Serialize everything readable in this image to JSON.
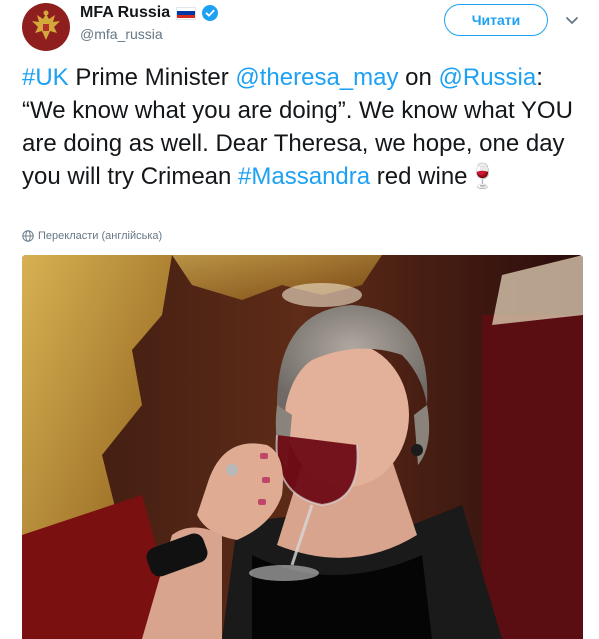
{
  "user": {
    "display_name": "MFA Russia",
    "handle": "@mfa_russia",
    "flag_icon": "russian-flag-icon",
    "verified_icon": "verified-badge-icon"
  },
  "actions": {
    "follow_label": "Читати",
    "menu_icon": "chevron-down-icon"
  },
  "tweet": {
    "hashtag_uk": "#UK",
    "text1": " Prime Minister ",
    "mention_may": "@theresa_may",
    "text2": " on ",
    "mention_russia": "@Russia",
    "text3": ": “We know what you are doing”. We know what YOU are doing as well. Dear Theresa, we hope, one day you will try Crimean ",
    "hashtag_massandra": "#Massandra",
    "text4": " red wine",
    "emoji": "🍷"
  },
  "translate": {
    "label": "Перекласти (англійська)",
    "icon": "globe-icon"
  },
  "media": {
    "icon": "photo-woman-drinking-red-wine"
  },
  "colors": {
    "link": "#1da1f2",
    "text": "#14171a",
    "muted": "#657786"
  }
}
